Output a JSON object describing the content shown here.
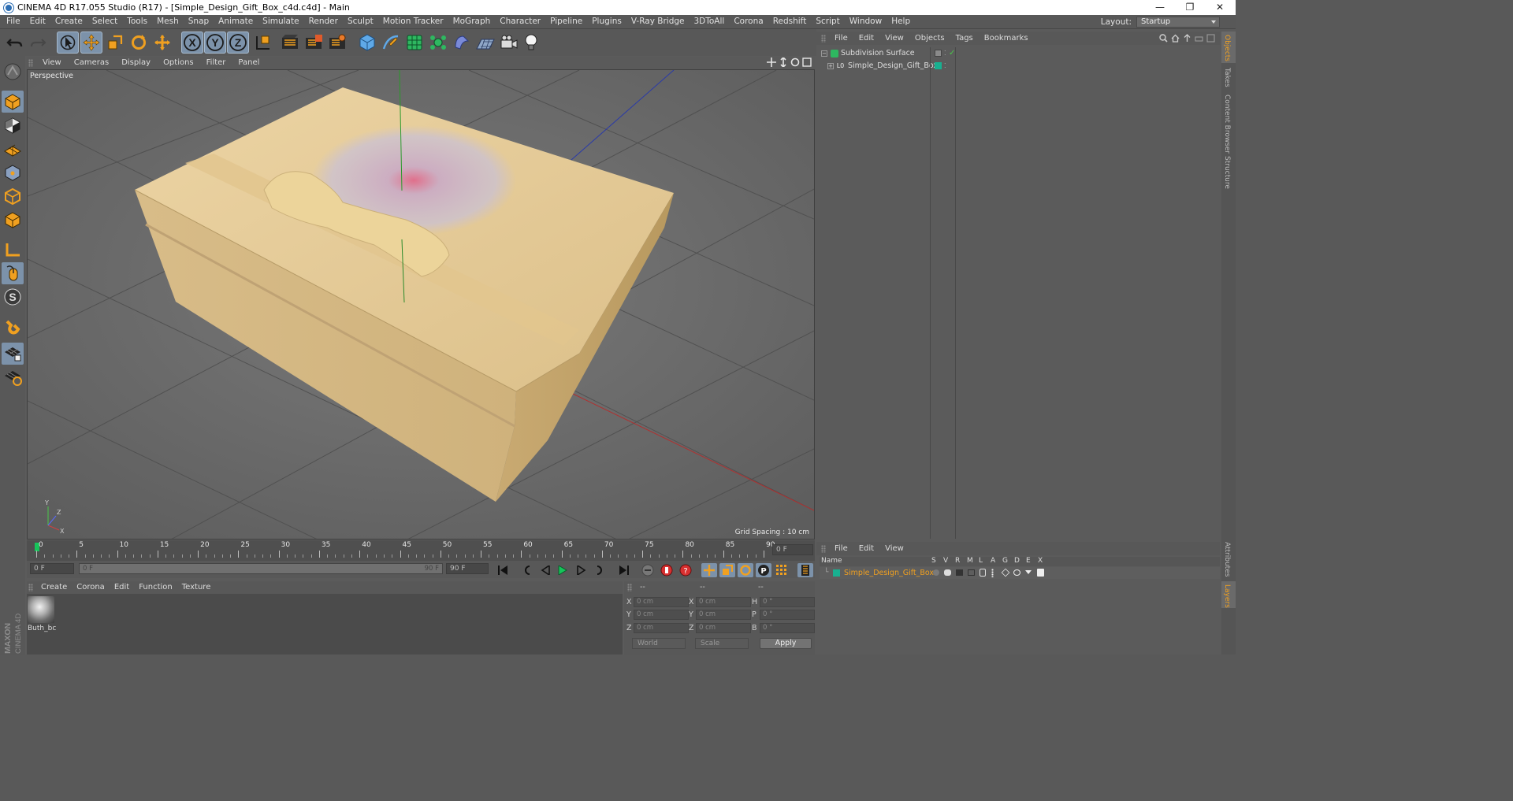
{
  "window": {
    "title": "CINEMA 4D R17.055 Studio (R17) - [Simple_Design_Gift_Box_c4d.c4d] - Main",
    "minimize": "—",
    "restore": "❐",
    "close": "✕"
  },
  "menu": [
    "File",
    "Edit",
    "Create",
    "Select",
    "Tools",
    "Mesh",
    "Snap",
    "Animate",
    "Simulate",
    "Render",
    "Sculpt",
    "Motion Tracker",
    "MoGraph",
    "Character",
    "Pipeline",
    "Plugins",
    "V-Ray Bridge",
    "3DToAll",
    "Corona",
    "Redshift",
    "Script",
    "Window",
    "Help"
  ],
  "layout": {
    "label": "Layout:",
    "value": "Startup"
  },
  "toolbar": {
    "axis_x": "X",
    "axis_y": "Y",
    "axis_z": "Z",
    "icons": [
      "undo-icon",
      "redo-icon",
      "select-arrow-icon",
      "move-icon",
      "scale-icon",
      "rotate-icon",
      "live-select-icon",
      "x-axis-icon",
      "y-axis-icon",
      "z-axis-icon",
      "world-coordinate-icon",
      "render-view-icon",
      "render-picture-viewer-icon",
      "render-settings-icon",
      "cube-icon",
      "pen-spline-icon",
      "subdivision-surface-icon",
      "cloner-icon",
      "deformer-icon",
      "floor-icon",
      "camera-icon",
      "light-icon"
    ]
  },
  "left_tools": [
    "model-mode-icon",
    "texture-mode-icon",
    "workplane-mode-icon",
    "points-mode-icon",
    "edges-mode-icon",
    "polygons-mode-icon",
    "axis-mode-icon",
    "tweak-mode-icon",
    "solo-icon",
    "magnet-icon",
    "snap-grid-icon",
    "snap-lock-icon"
  ],
  "viewport": {
    "menu": [
      "View",
      "Cameras",
      "Display",
      "Options",
      "Filter",
      "Panel"
    ],
    "label": "Perspective",
    "grid_spacing": "Grid Spacing : 10 cm",
    "axis_labels": {
      "x": "X",
      "y": "Y",
      "z": "Z"
    }
  },
  "timeline": {
    "ticks": [
      "0",
      "5",
      "10",
      "15",
      "20",
      "25",
      "30",
      "35",
      "40",
      "45",
      "50",
      "55",
      "60",
      "65",
      "70",
      "75",
      "80",
      "85",
      "90"
    ],
    "current_frame": "0 F",
    "start_field": "0 F",
    "range_start": "0 F",
    "range_end": "90 F",
    "end_field": "90 F"
  },
  "materials": {
    "menu": [
      "Create",
      "Corona",
      "Edit",
      "Function",
      "Texture"
    ],
    "items": [
      {
        "name": "Buth_bc"
      }
    ]
  },
  "coordinates": {
    "headers": [
      "--",
      "--",
      "--"
    ],
    "rows": [
      {
        "l1": "X",
        "v1": "0 cm",
        "l2": "X",
        "v2": "0 cm",
        "l3": "H",
        "v3": "0 °"
      },
      {
        "l1": "Y",
        "v1": "0 cm",
        "l2": "Y",
        "v2": "0 cm",
        "l3": "P",
        "v3": "0 °"
      },
      {
        "l1": "Z",
        "v1": "0 cm",
        "l2": "Z",
        "v2": "0 cm",
        "l3": "B",
        "v3": "0 °"
      }
    ],
    "space": "World",
    "mode": "Scale",
    "apply": "Apply"
  },
  "objects": {
    "menu": [
      "File",
      "Edit",
      "View",
      "Objects",
      "Tags",
      "Bookmarks"
    ],
    "items": [
      {
        "name": "Subdivision Surface",
        "color": "#dedede"
      },
      {
        "name": "Simple_Design_Gift_Box",
        "color": "#dedede"
      }
    ]
  },
  "layers": {
    "menu": [
      "File",
      "Edit",
      "View"
    ],
    "columns": [
      "Name",
      "S",
      "V",
      "R",
      "M",
      "L",
      "A",
      "G",
      "D",
      "E",
      "X"
    ],
    "items": [
      {
        "name": "Simple_Design_Gift_Box",
        "color": "#f0a020",
        "swatch": "#18b090"
      }
    ]
  },
  "right_tabs": [
    "Objects",
    "Takes",
    "Content Browser",
    "Structure",
    "Attributes",
    "Layers"
  ],
  "brand": {
    "line1": "MAXON",
    "line2": "CINEMA 4D"
  },
  "colors": {
    "accent": "#f0a020",
    "selection_blue": "#7c92aa",
    "viewport_bg": "#6b6b6b"
  }
}
